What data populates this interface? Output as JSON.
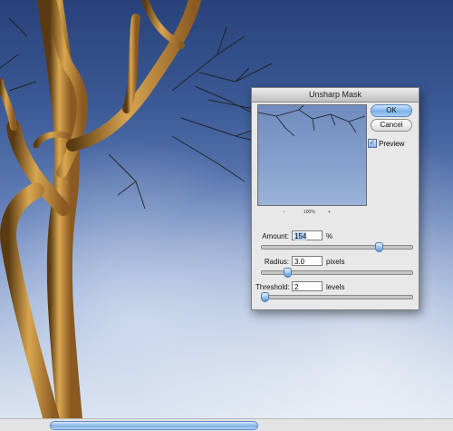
{
  "dialog": {
    "title": "Unsharp Mask",
    "ok_label": "OK",
    "cancel_label": "Cancel",
    "preview_label": "Preview",
    "preview_checked": true,
    "zoom": {
      "minus": "−",
      "level": "100%",
      "plus": "+"
    },
    "amount": {
      "label": "Amount:",
      "value": "154",
      "unit": "%",
      "slider_fraction": 0.77
    },
    "radius": {
      "label": "Radius:",
      "value": "3.0",
      "unit": "pixels",
      "slider_fraction": 0.16
    },
    "threshold": {
      "label": "Threshold:",
      "value": "2",
      "unit": "levels",
      "slider_fraction": 0.01
    }
  },
  "icons": {
    "preview_check": "checkmark-icon"
  },
  "colors": {
    "accent": "#7fb0e6",
    "sky_top": "#28427a",
    "bark": "#b98a3a"
  }
}
